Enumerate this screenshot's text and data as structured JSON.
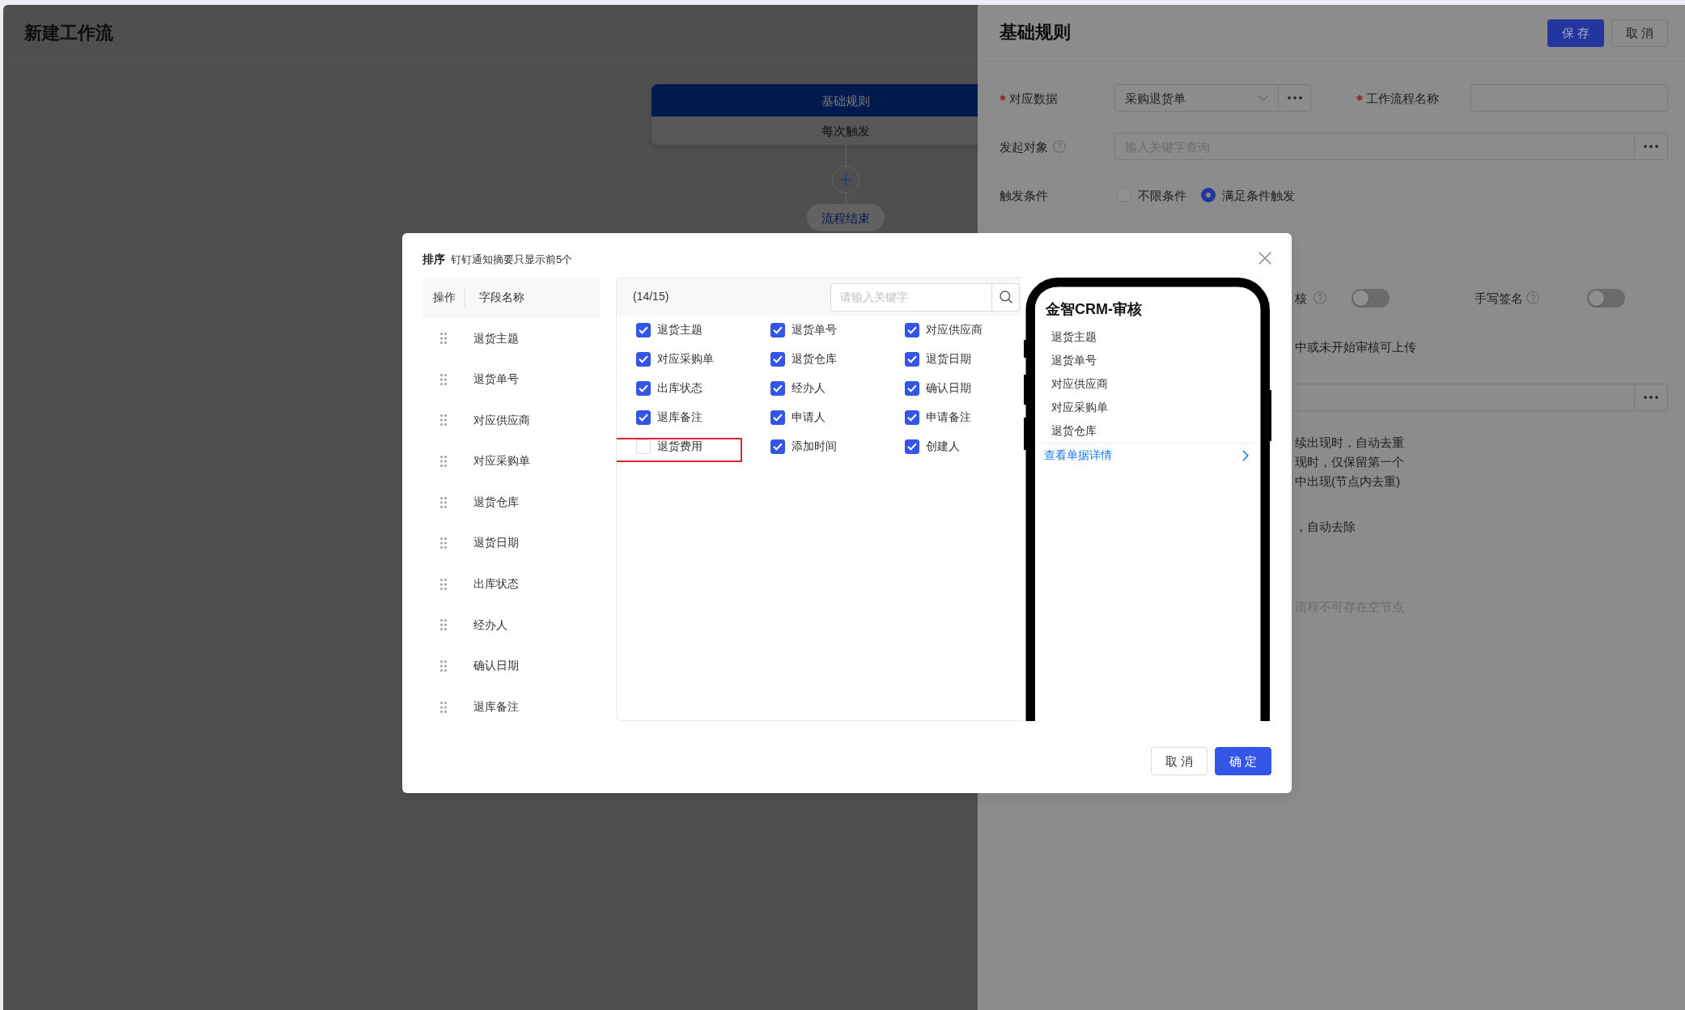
{
  "page": {
    "title": "新建工作流",
    "flow": {
      "start_node": {
        "title": "基础规则",
        "subtitle": "每次触发"
      },
      "end_node": "流程结束"
    }
  },
  "drawer": {
    "title": "基础规则",
    "buttons": [
      {
        "label": "保存",
        "kind": "primary"
      },
      {
        "label": "取消",
        "kind": "default"
      }
    ],
    "form_rows": [
      [
        {
          "kind": "select",
          "label": "对应数据",
          "required": true,
          "help": false,
          "value": "采购退货单"
        },
        {
          "kind": "input",
          "label": "工作流程名称",
          "required": true,
          "help": false
        }
      ],
      [
        {
          "kind": "picker",
          "label": "发起对象",
          "required": false,
          "help": true,
          "placeholder": "输入关键字查询"
        }
      ],
      [
        {
          "kind": "radio",
          "label": "触发条件",
          "required": false,
          "help": false,
          "options": [
            {
              "label": "不限条件",
              "selected": false
            },
            {
              "label": "满足条件触发",
              "selected": true
            }
          ]
        }
      ]
    ],
    "covered_rows": [
      {
        "kind": "switches",
        "items": [
          {
            "label": "核",
            "help": true,
            "on": false
          },
          {
            "label": "手写签名",
            "help": true,
            "on": false
          }
        ]
      },
      {
        "kind": "note",
        "text": "中或未开始审核可上传"
      },
      {
        "kind": "picker"
      },
      {
        "kind": "lines",
        "lines": [
          "续出现时，自动去重",
          "现时，仅保留第一个",
          "中出现(节点内去重)"
        ]
      },
      {
        "kind": "note",
        "text": "，自动去除"
      },
      {
        "kind": "muted_note",
        "text": "流程不可存在空节点"
      }
    ]
  },
  "modal": {
    "title": "排序",
    "hint": "钉钉通知摘要只显示前5个",
    "sort_table": {
      "columns": [
        "操作",
        "字段名称"
      ],
      "rows": [
        "退货主题",
        "退货单号",
        "对应供应商",
        "对应采购单",
        "退货仓库",
        "退货日期",
        "出库状态",
        "经办人",
        "确认日期",
        "退库备注"
      ]
    },
    "field_picker": {
      "count": "(14/15)",
      "search_placeholder": "请输入关键字",
      "options": [
        {
          "label": "退货主题",
          "checked": true,
          "highlighted": false
        },
        {
          "label": "退货单号",
          "checked": true,
          "highlighted": false
        },
        {
          "label": "对应供应商",
          "checked": true,
          "highlighted": false
        },
        {
          "label": "对应采购单",
          "checked": true,
          "highlighted": false
        },
        {
          "label": "退货仓库",
          "checked": true,
          "highlighted": false
        },
        {
          "label": "退货日期",
          "checked": true,
          "highlighted": false
        },
        {
          "label": "出库状态",
          "checked": true,
          "highlighted": false
        },
        {
          "label": "经办人",
          "checked": true,
          "highlighted": false
        },
        {
          "label": "确认日期",
          "checked": true,
          "highlighted": false
        },
        {
          "label": "退库备注",
          "checked": true,
          "highlighted": false
        },
        {
          "label": "申请人",
          "checked": true,
          "highlighted": false
        },
        {
          "label": "申请备注",
          "checked": true,
          "highlighted": false
        },
        {
          "label": "退货费用",
          "checked": false,
          "highlighted": true
        },
        {
          "label": "添加时间",
          "checked": true,
          "highlighted": false
        },
        {
          "label": "创建人",
          "checked": true,
          "highlighted": false
        }
      ]
    },
    "preview": {
      "title": "金智CRM-审核",
      "fields": [
        "退货主题",
        "退货单号",
        "对应供应商",
        "对应采购单",
        "退货仓库"
      ],
      "link": "查看单据详情"
    },
    "buttons": [
      {
        "label": "取消",
        "kind": "default"
      },
      {
        "label": "确定",
        "kind": "primary"
      }
    ]
  }
}
